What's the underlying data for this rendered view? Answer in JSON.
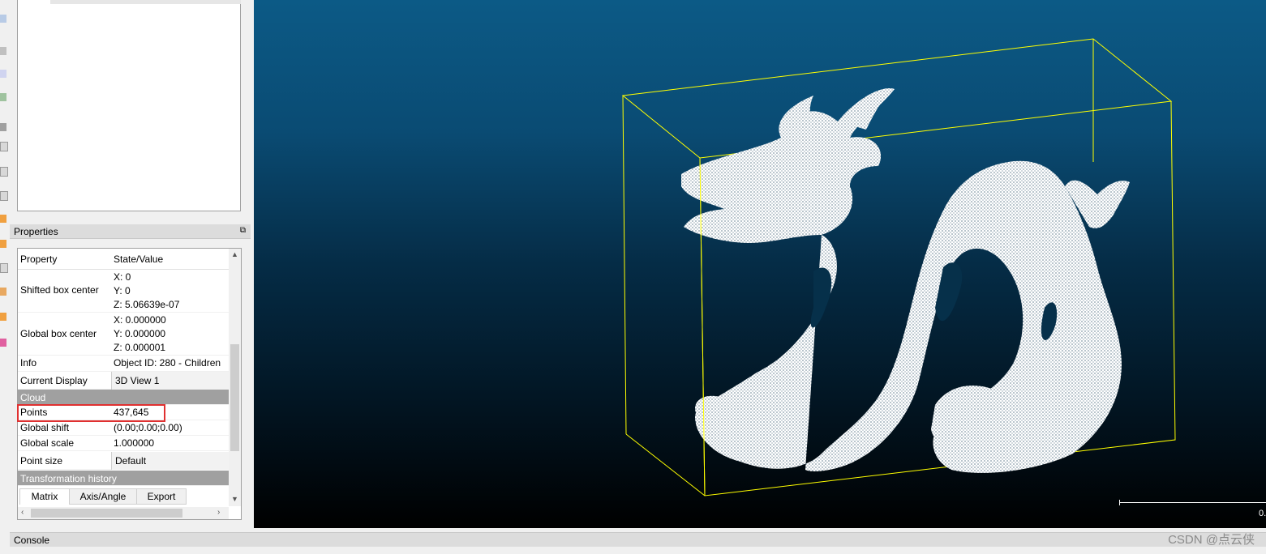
{
  "properties_panel": {
    "title": "Properties",
    "columns": [
      "Property",
      "State/Value"
    ],
    "rows": {
      "shifted_box_center": {
        "label": "Shifted box center",
        "x": "X: 0",
        "y": "Y: 0",
        "z": "Z: 5.06639e-07"
      },
      "global_box_center": {
        "label": "Global box center",
        "x": "X: 0.000000",
        "y": "Y: 0.000000",
        "z": "Z: 0.000001"
      },
      "info": {
        "label": "Info",
        "value": "Object ID: 280 - Children"
      },
      "current_display": {
        "label": "Current Display",
        "value": "3D View 1"
      },
      "cloud_section": "Cloud",
      "points": {
        "label": "Points",
        "value": "437,645"
      },
      "global_shift": {
        "label": "Global shift",
        "value": "(0.00;0.00;0.00)"
      },
      "global_scale": {
        "label": "Global scale",
        "value": "1.000000"
      },
      "point_size": {
        "label": "Point size",
        "value": "Default"
      },
      "transformation_section": "Transformation history"
    },
    "tabs": [
      "Matrix",
      "Axis/Angle",
      "Export"
    ],
    "active_tab": "Matrix"
  },
  "viewport": {
    "background_top": "#0c5a86",
    "background_bottom": "#000000",
    "bounding_box_color": "#ffff00",
    "point_color": "#ffffff",
    "scale_label": "0."
  },
  "console": {
    "title": "Console"
  },
  "watermark": "CSDN @点云侠",
  "highlight_color": "#e03030"
}
